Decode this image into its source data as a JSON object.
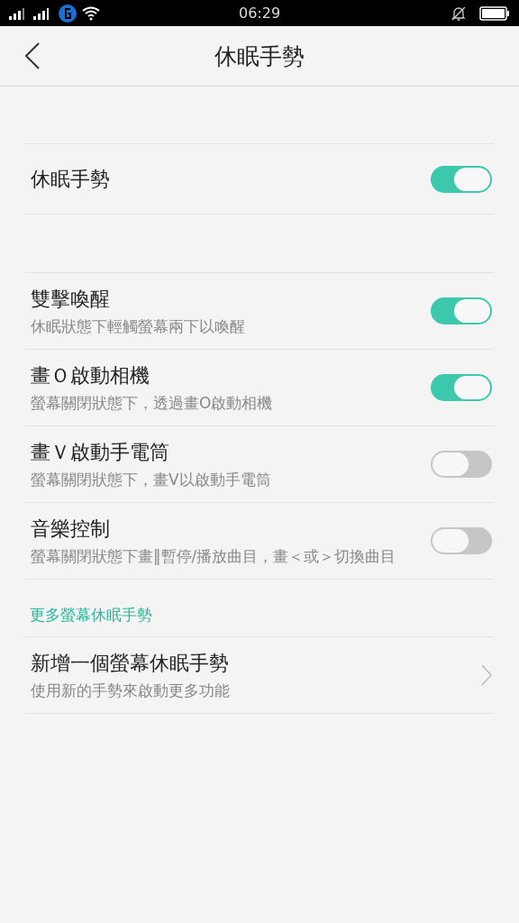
{
  "status_bar": {
    "time": "06:29"
  },
  "header": {
    "title": "休眠手勢"
  },
  "master": {
    "label": "休眠手勢",
    "on": true
  },
  "gestures": [
    {
      "title": "雙擊喚醒",
      "subtitle": "休眠狀態下輕觸螢幕兩下以喚醒",
      "on": true
    },
    {
      "title": "畫Ｏ啟動相機",
      "subtitle": "螢幕關閉狀態下，透過畫O啟動相機",
      "on": true
    },
    {
      "title": "畫Ｖ啟動手電筒",
      "subtitle": "螢幕關閉狀態下，畫V以啟動手電筒",
      "on": false
    },
    {
      "title": "音樂控制",
      "subtitle": "螢幕關閉狀態下畫‖暫停/播放曲目，畫＜或＞切換曲目",
      "on": false
    }
  ],
  "more": {
    "heading": "更多螢幕休眠手勢",
    "items": [
      {
        "title": "新增一個螢幕休眠手勢",
        "subtitle": "使用新的手勢來啟動更多功能"
      }
    ]
  }
}
